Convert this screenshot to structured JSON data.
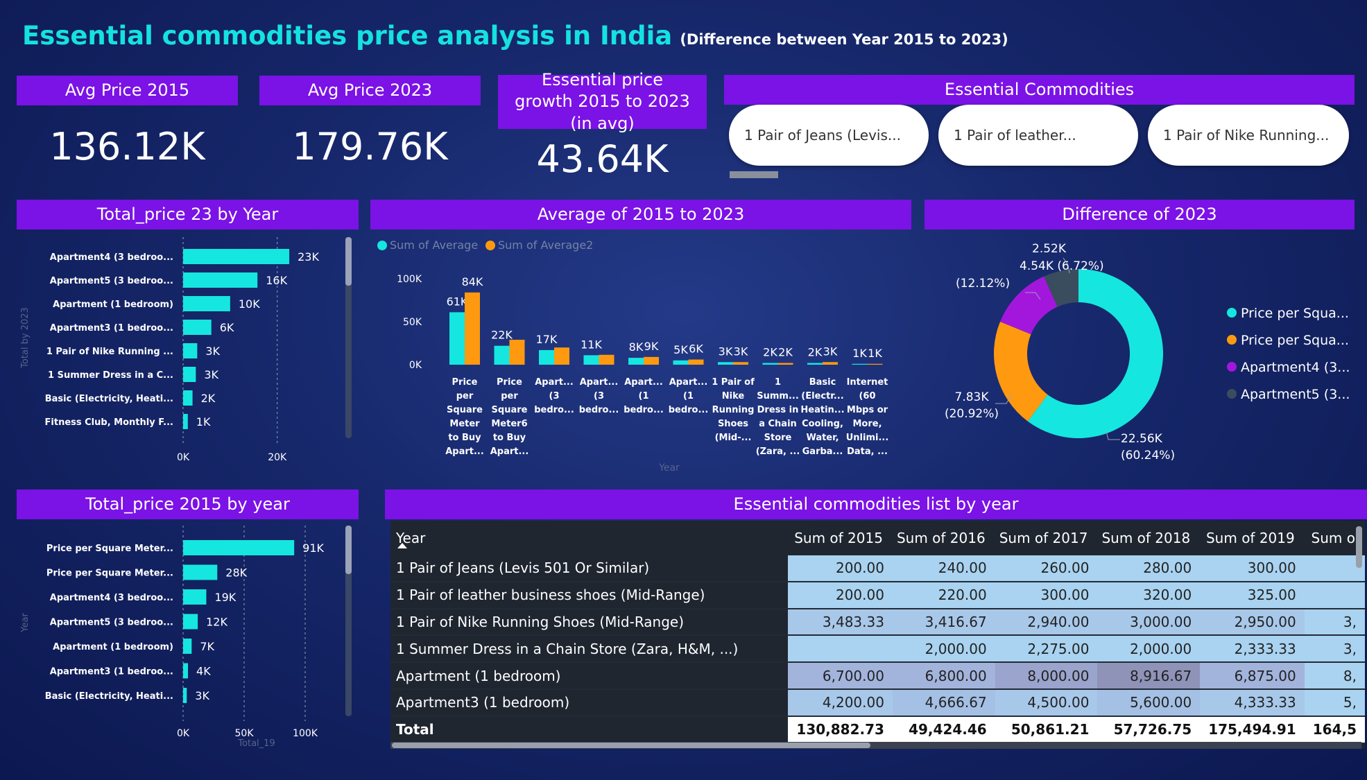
{
  "title": "Essential commodities price analysis in India",
  "subtitle": "(Difference between Year 2015 to 2023)",
  "kpis": {
    "avg2015_label": "Avg Price 2015",
    "avg2015_value": "136.12K",
    "avg2023_label": "Avg Price 2023",
    "avg2023_value": "179.76K",
    "growth_label": "Essential price growth 2015 to 2023 (in avg)",
    "growth_value": "43.64K"
  },
  "slicer": {
    "title": "Essential Commodities",
    "items": [
      "1 Pair of Jeans (Levis...",
      "1 Pair of leather...",
      "1 Pair of Nike Running..."
    ]
  },
  "colors": {
    "cyan": "#16e6e0",
    "orange": "#ff9a10",
    "purple": "#a317dd",
    "slate": "#3a4d5e",
    "accent": "#7b12e6"
  },
  "chart_data": [
    {
      "id": "bar23",
      "title": "Total_price 23 by Year",
      "type": "bar",
      "orientation": "horizontal",
      "ylabel": "Total by 2023",
      "categories": [
        "Apartment4 (3 bedroo...",
        "Apartment5 (3 bedroo...",
        "Apartment (1 bedroom)",
        "Apartment3 (1 bedroo...",
        "1 Pair of Nike Running ...",
        "1 Summer Dress in a C...",
        "Basic (Electricity, Heati...",
        "Fitness Club, Monthly F..."
      ],
      "values": [
        22560,
        15800,
        10000,
        6000,
        3000,
        2700,
        2000,
        1000
      ],
      "labels": [
        "23K",
        "16K",
        "10K",
        "6K",
        "3K",
        "3K",
        "2K",
        "1K"
      ],
      "xlim": [
        0,
        28000
      ],
      "xticks": [
        "0K",
        "20K"
      ],
      "xtick_values": [
        0,
        20000
      ]
    },
    {
      "id": "avg",
      "title": "Average of 2015 to 2023",
      "type": "bar",
      "xlabel": "Year",
      "legend": [
        "Sum of Average",
        "Sum of Average2"
      ],
      "legend_position": "top-left",
      "categories": [
        [
          "Price",
          "per",
          "Square",
          "Meter",
          "to Buy",
          "Apart..."
        ],
        [
          "Price",
          "per",
          "Square",
          "Meter6",
          "to Buy",
          "Apart..."
        ],
        [
          "Apart...",
          "(3",
          "bedro..."
        ],
        [
          "Apart...",
          "(3",
          "bedro..."
        ],
        [
          "Apart...",
          "(1",
          "bedro..."
        ],
        [
          "Apart...",
          "(1",
          "bedro..."
        ],
        [
          "1 Pair of",
          "Nike",
          "Running",
          "Shoes",
          "(Mid-..."
        ],
        [
          "1",
          "Summ...",
          "Dress in",
          "a Chain",
          "Store",
          "(Zara, ..."
        ],
        [
          "Basic",
          "(Electr...",
          "Heatin...",
          "Cooling,",
          "Water,",
          "Garba..."
        ],
        [
          "Internet",
          "(60",
          "Mbps or",
          "More,",
          "Unlimi...",
          "Data, ..."
        ]
      ],
      "series": [
        {
          "name": "Sum of Average",
          "values": [
            61000,
            22000,
            17000,
            11000,
            8000,
            5000,
            3000,
            2000,
            2000,
            1000
          ],
          "labels": [
            "61K",
            "22K",
            "17K",
            "11K",
            "8K",
            "5K",
            "3K",
            "2K",
            "2K",
            "1K"
          ]
        },
        {
          "name": "Sum of Average2",
          "values": [
            84000,
            29000,
            20000,
            11500,
            9000,
            6000,
            3000,
            2000,
            3000,
            1000
          ],
          "labels": [
            "84K",
            "",
            "",
            "",
            "9K",
            "6K",
            "3K",
            "2K",
            "3K",
            "1K"
          ]
        }
      ],
      "ylim": [
        0,
        100000
      ],
      "yticks": [
        "0K",
        "50K",
        "100K"
      ],
      "ytick_values": [
        0,
        50000,
        100000
      ]
    },
    {
      "id": "donut",
      "title": "Difference of 2023",
      "type": "pie",
      "donut": true,
      "categories": [
        "Price per Squa...",
        "Price per Squa...",
        "Apartment4 (3...",
        "Apartment5 (3..."
      ],
      "values": [
        22560,
        7830,
        4540,
        2520
      ],
      "labels": [
        "22.56K (60.24%)",
        "7.83K (20.92%)",
        "4.54K (6.72%) (12.12%)",
        "2.52K"
      ],
      "legend_position": "right"
    },
    {
      "id": "bar15",
      "title": "Total_price 2015 by year",
      "type": "bar",
      "orientation": "horizontal",
      "ylabel": "Year",
      "xlabel": "Total_19",
      "categories": [
        "Price per Square Meter...",
        "Price per Square Meter...",
        "Apartment4 (3 bedroo...",
        "Apartment5 (3 bedroo...",
        "Apartment (1 bedroom)",
        "Apartment3 (1 bedroo...",
        "Basic (Electricity, Heati..."
      ],
      "values": [
        91000,
        28000,
        19000,
        12000,
        7000,
        4000,
        3000
      ],
      "labels": [
        "91K",
        "28K",
        "19K",
        "12K",
        "7K",
        "4K",
        "3K"
      ],
      "xlim": [
        0,
        125000
      ],
      "xticks": [
        "0K",
        "50K",
        "100K"
      ],
      "xtick_values": [
        0,
        50000,
        100000
      ]
    },
    {
      "id": "table",
      "title": "Essential commodities list by year",
      "type": "table",
      "columns": [
        "Year",
        "Sum of 2015",
        "Sum of 2016",
        "Sum of 2017",
        "Sum of 2018",
        "Sum of 2019",
        "Sum o"
      ],
      "rows": [
        [
          "1 Pair of Jeans (Levis 501 Or Similar)",
          "200.00",
          "240.00",
          "260.00",
          "280.00",
          "300.00",
          ""
        ],
        [
          "1 Pair of leather business shoes (Mid-Range)",
          "200.00",
          "220.00",
          "300.00",
          "320.00",
          "325.00",
          ""
        ],
        [
          "1 Pair of Nike Running Shoes (Mid-Range)",
          "3,483.33",
          "3,416.67",
          "2,940.00",
          "3,000.00",
          "2,950.00",
          "3,"
        ],
        [
          "1 Summer Dress in a Chain Store (Zara, H&M, ...)",
          "",
          "2,000.00",
          "2,275.00",
          "2,000.00",
          "2,333.33",
          "3,"
        ],
        [
          "Apartment (1 bedroom)",
          "6,700.00",
          "6,800.00",
          "8,000.00",
          "8,916.67",
          "6,875.00",
          "8,"
        ],
        [
          "Apartment3 (1 bedroom)",
          "4,200.00",
          "4,666.67",
          "4,500.00",
          "5,600.00",
          "4,333.33",
          "5,"
        ]
      ],
      "total": [
        "Total",
        "130,882.73",
        "49,424.46",
        "50,861.21",
        "57,726.75",
        "175,494.91",
        "164,5"
      ]
    }
  ]
}
